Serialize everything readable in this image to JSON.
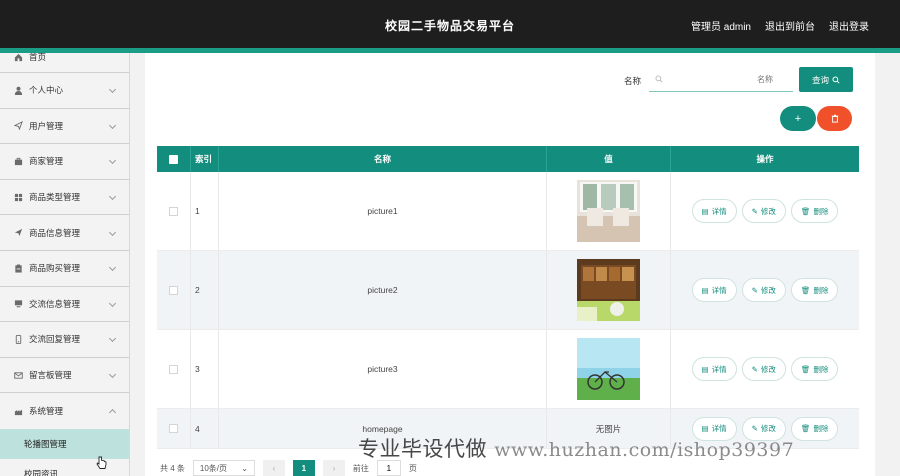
{
  "header": {
    "title": "校园二手物品交易平台",
    "nav": [
      "管理员 admin",
      "退出到前台",
      "退出登录"
    ]
  },
  "sidebar": {
    "items": [
      {
        "label": "首页",
        "icon": "home-icon"
      },
      {
        "label": "个人中心",
        "icon": "user-icon"
      },
      {
        "label": "用户管理",
        "icon": "send-icon"
      },
      {
        "label": "商家管理",
        "icon": "briefcase-icon"
      },
      {
        "label": "商品类型管理",
        "icon": "grid-icon"
      },
      {
        "label": "商品信息管理",
        "icon": "send-icon"
      },
      {
        "label": "商品购买管理",
        "icon": "clipboard-icon"
      },
      {
        "label": "交流信息管理",
        "icon": "monitor-icon"
      },
      {
        "label": "交流回复管理",
        "icon": "phone-icon"
      },
      {
        "label": "留言板管理",
        "icon": "mail-icon"
      },
      {
        "label": "系统管理",
        "icon": "settings-icon"
      }
    ],
    "sub_items": [
      {
        "label": "轮播图管理",
        "active": true
      },
      {
        "label": "校园资讯",
        "active": false
      }
    ]
  },
  "search": {
    "label": "名称",
    "placeholder": "名称",
    "button": "查询"
  },
  "actions": {
    "add": "+",
    "delete": "🗑"
  },
  "table": {
    "headers": [
      "索引",
      "名称",
      "值",
      "操作"
    ],
    "rows": [
      {
        "index": "1",
        "name": "picture1",
        "value_text": "",
        "thumb": "room-white"
      },
      {
        "index": "2",
        "name": "picture2",
        "value_text": "",
        "thumb": "shelf-green"
      },
      {
        "index": "3",
        "name": "picture3",
        "value_text": "",
        "thumb": "bike-sky"
      },
      {
        "index": "4",
        "name": "homepage",
        "value_text": "无图片",
        "thumb": ""
      }
    ],
    "ops": {
      "detail": "详情",
      "edit": "修改",
      "delete": "删除"
    }
  },
  "pager": {
    "total": "共 4 条",
    "page_size": "10条/页",
    "current": "1",
    "goto_label": "前往",
    "goto_value": "1",
    "page_unit": "页"
  },
  "watermark": {
    "cn": "专业毕设代做",
    "url": "www.huzhan.com/ishop39397"
  },
  "colors": {
    "primary": "#138d7d",
    "accent_line": "#1a9c87",
    "danger": "#f0502a",
    "header_bg": "#1e1e1e"
  }
}
